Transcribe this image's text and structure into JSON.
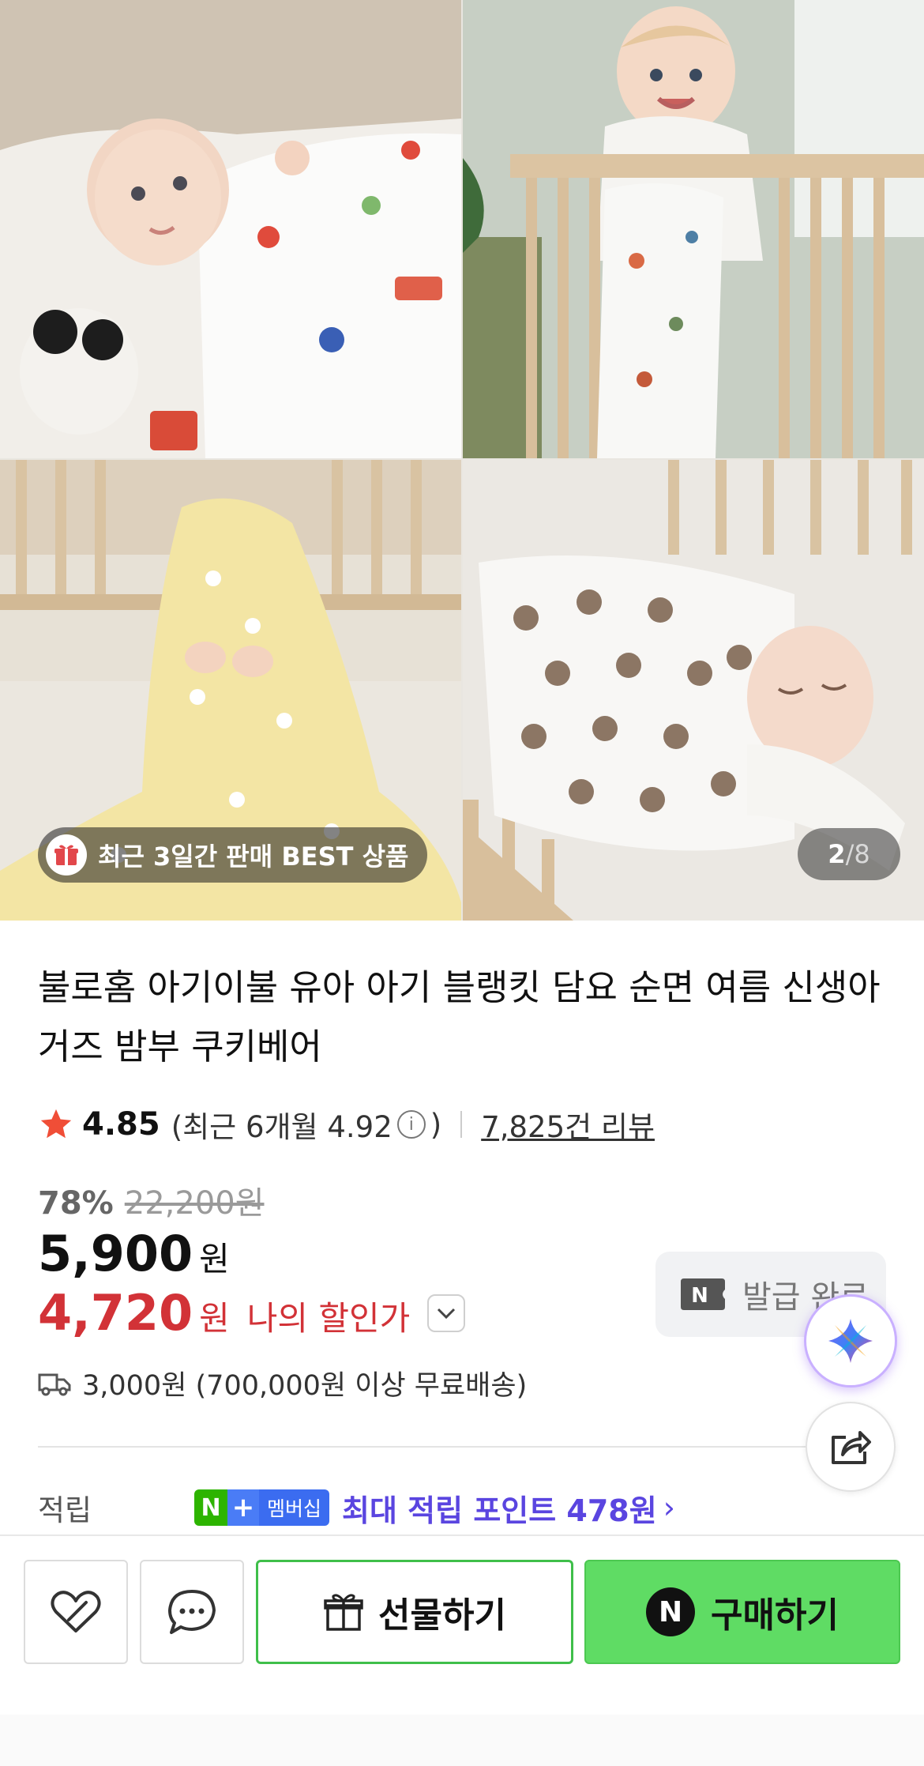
{
  "gallery": {
    "best_badge": "최근 3일간 판매 BEST 상품",
    "current_page": "2",
    "page_separator": "/",
    "total_pages": "8",
    "photos": [
      "baby-with-print-blanket",
      "baby-standing-in-crib",
      "baby-under-yellow-blanket",
      "baby-sleeping-bear-blanket"
    ]
  },
  "product": {
    "title": "불로홈 아기이불 유아 아기 블랭킷 담요 순면 여름 신생아 거즈 밤부 쿠키베어",
    "rating": "4.85",
    "recent_rating_prefix": "(최근 6개월 4.92",
    "recent_rating_suffix": ")",
    "info_symbol": "i",
    "reviews": "7,825건 리뷰",
    "discount_rate": "78%",
    "original_price": "22,200원",
    "price": "5,900",
    "price_unit": "원",
    "my_price": "4,720",
    "my_price_unit": "원",
    "my_price_label": "나의 할인가",
    "coupon_logo": "N",
    "coupon_status": "발급 완료",
    "shipping": "3,000원 (700,000원 이상 무료배송)",
    "points_label": "적립",
    "membership_n": "N",
    "membership_plus": "+",
    "membership_text": "멤버십",
    "max_points": "최대 적립 포인트 478원",
    "points_chevron": "›"
  },
  "bottom_bar": {
    "gift_label": "선물하기",
    "buy_logo": "N",
    "buy_label": "구매하기"
  },
  "colors": {
    "sale_red": "#d23237",
    "buy_green": "#5fdc64",
    "points_purple": "#5a45e0",
    "star": "#f04e37"
  },
  "icons": [
    "gift-icon",
    "star-icon",
    "info-icon",
    "chevron-down-icon",
    "truck-icon",
    "ai-sparkle-icon",
    "share-icon",
    "heart-icon",
    "chat-icon",
    "present-icon"
  ]
}
